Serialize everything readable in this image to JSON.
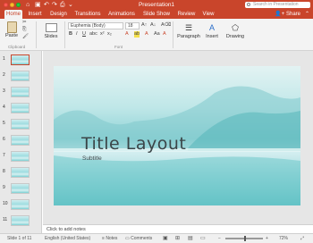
{
  "titlebar": {
    "title": "Presentation1",
    "search_placeholder": "Search in Presentation",
    "colors": {
      "accent": "#c9452b"
    }
  },
  "tabs": [
    "Home",
    "Insert",
    "Design",
    "Transitions",
    "Animations",
    "Slide Show",
    "Review",
    "View"
  ],
  "share_label": "Share",
  "ribbon": {
    "paste": "Paste",
    "clipboard_label": "Clipboard",
    "slides": "Slides",
    "font_name": "Euphemia (Body)",
    "font_size": "18",
    "font_label": "Font",
    "paragraph": "Paragraph",
    "insert": "Insert",
    "drawing": "Drawing"
  },
  "thumbnails": [
    "1",
    "2",
    "3",
    "4",
    "5",
    "6",
    "7",
    "8",
    "9",
    "10",
    "11"
  ],
  "slide": {
    "title": "Title Layout",
    "subtitle": "Subtitle"
  },
  "notes_placeholder": "Click to add notes",
  "status": {
    "slide_info": "Slide 1 of 11",
    "language": "English (United States)",
    "notes": "Notes",
    "comments": "Comments",
    "zoom": "72%"
  }
}
